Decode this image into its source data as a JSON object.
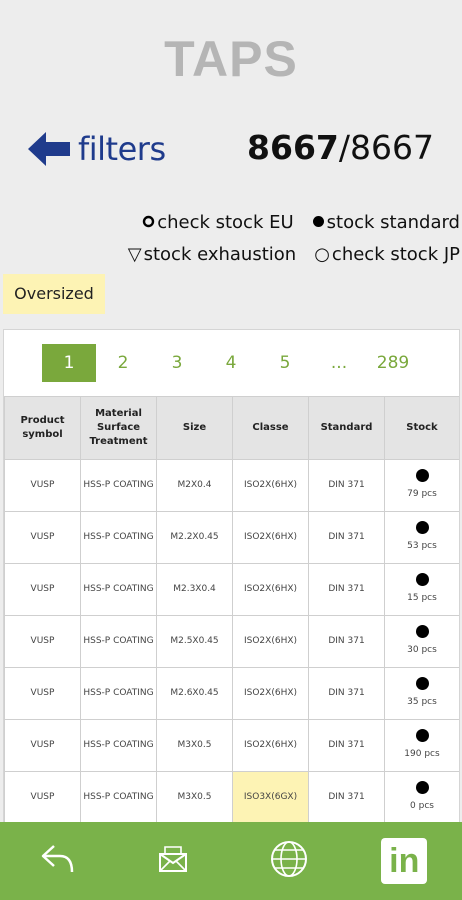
{
  "header": {
    "title": "TAPS",
    "back_label": "filters",
    "count_shown": "8667",
    "count_sep_total": "/8667"
  },
  "legend": {
    "check_eu": {
      "symbol": "●",
      "label": "check stock EU"
    },
    "standard": {
      "symbol": "●",
      "label": "stock standard"
    },
    "exhaustion": {
      "symbol": "▽",
      "label": "stock exhaustion"
    },
    "check_jp": {
      "symbol": "○",
      "label": "check stock JP"
    }
  },
  "filter_chip": "Oversized",
  "pagination": {
    "pages": [
      "1",
      "2",
      "3",
      "4",
      "5",
      "...",
      "289"
    ],
    "active": "1"
  },
  "table": {
    "headers": [
      "Product symbol",
      "Material Surface Treatment",
      "Size",
      "Classe",
      "Standard",
      "Stock"
    ],
    "rows": [
      {
        "symbol": "VUSP",
        "material": "HSS-P COATING",
        "size": "M2X0.4",
        "classe": "ISO2X(6HX)",
        "standard": "DIN 371",
        "stock": "79 pcs",
        "highlight": false
      },
      {
        "symbol": "VUSP",
        "material": "HSS-P COATING",
        "size": "M2.2X0.45",
        "classe": "ISO2X(6HX)",
        "standard": "DIN 371",
        "stock": "53 pcs",
        "highlight": false
      },
      {
        "symbol": "VUSP",
        "material": "HSS-P COATING",
        "size": "M2.3X0.4",
        "classe": "ISO2X(6HX)",
        "standard": "DIN 371",
        "stock": "15 pcs",
        "highlight": false
      },
      {
        "symbol": "VUSP",
        "material": "HSS-P COATING",
        "size": "M2.5X0.45",
        "classe": "ISO2X(6HX)",
        "standard": "DIN 371",
        "stock": "30 pcs",
        "highlight": false
      },
      {
        "symbol": "VUSP",
        "material": "HSS-P COATING",
        "size": "M2.6X0.45",
        "classe": "ISO2X(6HX)",
        "standard": "DIN 371",
        "stock": "35 pcs",
        "highlight": false
      },
      {
        "symbol": "VUSP",
        "material": "HSS-P COATING",
        "size": "M3X0.5",
        "classe": "ISO2X(6HX)",
        "standard": "DIN 371",
        "stock": "190 pcs",
        "highlight": false
      },
      {
        "symbol": "VUSP",
        "material": "HSS-P COATING",
        "size": "M3X0.5",
        "classe": "ISO3X(6GX)",
        "standard": "DIN 371",
        "stock": "0 pcs",
        "highlight": true
      }
    ]
  },
  "bottom_bar": {
    "icons": [
      "back-arrow-icon",
      "mail-icon",
      "globe-icon",
      "linkedin-icon"
    ],
    "linkedin_text": "in"
  },
  "colors": {
    "brand_green": "#7ab24a",
    "navy": "#1f3b8c",
    "highlight_yellow": "#fdf3b4"
  }
}
